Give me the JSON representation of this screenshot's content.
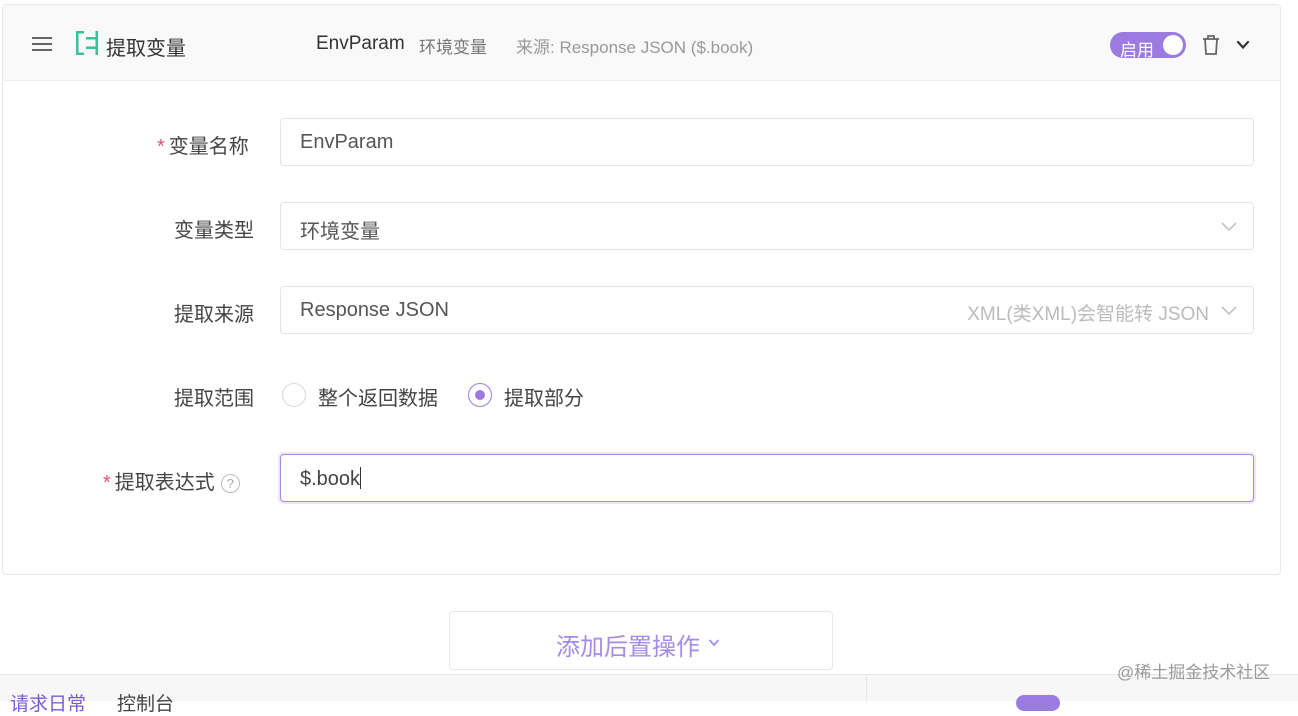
{
  "header": {
    "title": "提取变量",
    "var_name": "EnvParam",
    "var_type": "环境变量",
    "source": "来源: Response JSON ($.book)",
    "toggle_label": "启用",
    "toggle_on": true,
    "icons": [
      "drag-handle-icon",
      "extract-variable-icon",
      "trash-icon",
      "chevron-down-icon"
    ]
  },
  "form": {
    "name": {
      "label": "变量名称",
      "required_mark": "*",
      "value": "EnvParam"
    },
    "type": {
      "label": "变量类型",
      "value": "环境变量"
    },
    "source": {
      "label": "提取来源",
      "value": "Response JSON",
      "hint": "XML(类XML)会智能转 JSON"
    },
    "scope": {
      "label": "提取范围",
      "options": [
        "整个返回数据",
        "提取部分"
      ],
      "selected": "提取部分"
    },
    "expression": {
      "label": "提取表达式",
      "required_mark": "*",
      "help": "?",
      "value": "$.book"
    }
  },
  "add_post_action": {
    "label": "添加后置操作"
  },
  "bottom": {
    "tabs": [
      "请求日常",
      "控制台"
    ]
  },
  "watermark": "@稀土掘金技术社区",
  "colors": {
    "accent": "#9b7be0",
    "required": "#e0507a",
    "extract_icon": "#3cc09a"
  }
}
